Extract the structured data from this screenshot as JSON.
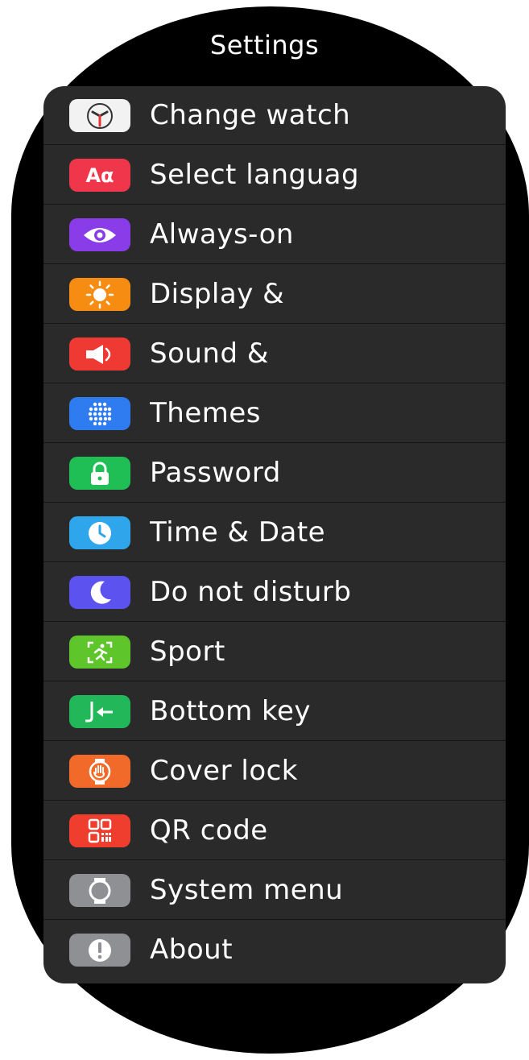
{
  "title": "Settings",
  "colors": {
    "change_watch": "#f2f2f2",
    "select_language": "#f0364a",
    "always_on": "#8a3ce8",
    "display": "#f68d12",
    "sound": "#ee3a32",
    "themes": "#2f7bf0",
    "password": "#1fbf55",
    "time_date": "#2fa6ec",
    "do_not_disturb": "#5b52f0",
    "sport": "#5ec62a",
    "bottom_key": "#22b85a",
    "cover_lock": "#f26a2a",
    "qr_code": "#ef3e2e",
    "system_menu": "#8e9094",
    "about": "#8e9094"
  },
  "items": [
    {
      "label": "Change watch",
      "icon": "watch-face-icon"
    },
    {
      "label": "Select languag",
      "icon": "language-icon",
      "icon_text": "Aα"
    },
    {
      "label": "Always-on",
      "icon": "eye-icon"
    },
    {
      "label": "Display &",
      "icon": "sun-icon"
    },
    {
      "label": "Sound &",
      "icon": "speaker-icon"
    },
    {
      "label": "Themes",
      "icon": "dots-grid-icon"
    },
    {
      "label": "Password",
      "icon": "lock-icon"
    },
    {
      "label": "Time & Date",
      "icon": "clock-icon"
    },
    {
      "label": "Do not disturb",
      "icon": "moon-icon"
    },
    {
      "label": "Sport",
      "icon": "running-icon"
    },
    {
      "label": "Bottom key",
      "icon": "bottom-key-icon"
    },
    {
      "label": "Cover lock",
      "icon": "hand-lock-icon"
    },
    {
      "label": "QR code",
      "icon": "qr-code-icon"
    },
    {
      "label": "System menu",
      "icon": "system-watch-icon"
    },
    {
      "label": "About",
      "icon": "info-icon"
    }
  ]
}
